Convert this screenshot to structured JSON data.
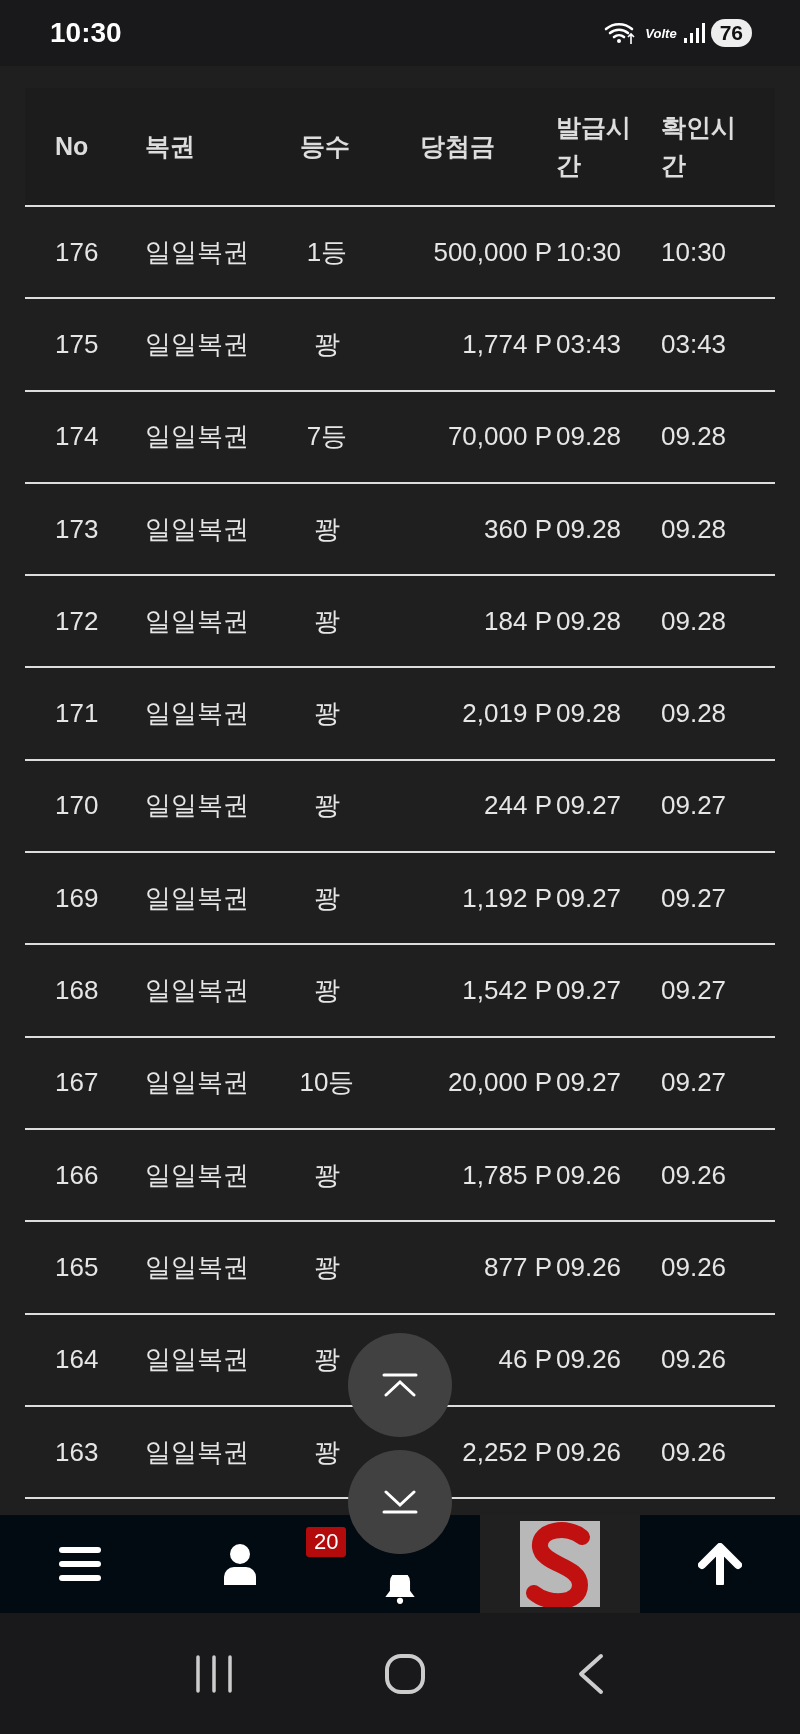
{
  "status_bar": {
    "time": "10:30",
    "network": "Volte",
    "battery": "76"
  },
  "table": {
    "columns": [
      "No",
      "복권",
      "등수",
      "당첨금",
      "발급시간",
      "확인시간"
    ],
    "rows": [
      {
        "no": "176",
        "ticket": "일일복권",
        "rank": "1등",
        "prize": "500,000 P",
        "issued_time": "10:30",
        "checked_time": "10:30"
      },
      {
        "no": "175",
        "ticket": "일일복권",
        "rank": "꽝",
        "prize": "1,774 P",
        "issued_time": "03:43",
        "checked_time": "03:43"
      },
      {
        "no": "174",
        "ticket": "일일복권",
        "rank": "7등",
        "prize": "70,000 P",
        "issued_time": "09.28",
        "checked_time": "09.28"
      },
      {
        "no": "173",
        "ticket": "일일복권",
        "rank": "꽝",
        "prize": "360 P",
        "issued_time": "09.28",
        "checked_time": "09.28"
      },
      {
        "no": "172",
        "ticket": "일일복권",
        "rank": "꽝",
        "prize": "184 P",
        "issued_time": "09.28",
        "checked_time": "09.28"
      },
      {
        "no": "171",
        "ticket": "일일복권",
        "rank": "꽝",
        "prize": "2,019 P",
        "issued_time": "09.28",
        "checked_time": "09.28"
      },
      {
        "no": "170",
        "ticket": "일일복권",
        "rank": "꽝",
        "prize": "244 P",
        "issued_time": "09.27",
        "checked_time": "09.27"
      },
      {
        "no": "169",
        "ticket": "일일복권",
        "rank": "꽝",
        "prize": "1,192 P",
        "issued_time": "09.27",
        "checked_time": "09.27"
      },
      {
        "no": "168",
        "ticket": "일일복권",
        "rank": "꽝",
        "prize": "1,542 P",
        "issued_time": "09.27",
        "checked_time": "09.27"
      },
      {
        "no": "167",
        "ticket": "일일복권",
        "rank": "10등",
        "prize": "20,000 P",
        "issued_time": "09.27",
        "checked_time": "09.27"
      },
      {
        "no": "166",
        "ticket": "일일복권",
        "rank": "꽝",
        "prize": "1,785 P",
        "issued_time": "09.26",
        "checked_time": "09.26"
      },
      {
        "no": "165",
        "ticket": "일일복권",
        "rank": "꽝",
        "prize": "877 P",
        "issued_time": "09.26",
        "checked_time": "09.26"
      },
      {
        "no": "164",
        "ticket": "일일복권",
        "rank": "꽝",
        "prize": "46 P",
        "issued_time": "09.26",
        "checked_time": "09.26"
      },
      {
        "no": "163",
        "ticket": "일일복권",
        "rank": "꽝",
        "prize": "2,252 P",
        "issued_time": "09.26",
        "checked_time": "09.26"
      }
    ]
  },
  "bottom_nav": {
    "notification_badge": "20"
  }
}
